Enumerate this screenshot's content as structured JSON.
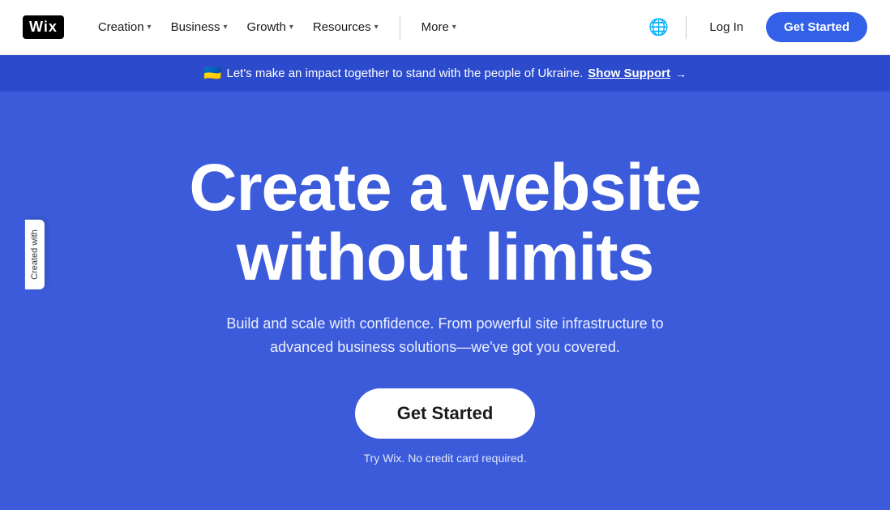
{
  "logo": {
    "text": "Wix"
  },
  "nav": {
    "items": [
      {
        "label": "Creation",
        "hasChevron": true
      },
      {
        "label": "Business",
        "hasChevron": true
      },
      {
        "label": "Growth",
        "hasChevron": true
      },
      {
        "label": "Resources",
        "hasChevron": true
      }
    ],
    "more": {
      "label": "More",
      "hasChevron": true
    },
    "login": "Log In",
    "get_started": "Get Started"
  },
  "banner": {
    "flag": "🇺🇦",
    "text": "Let's make an impact together to stand with the people of Ukraine.",
    "link_text": "Show Support",
    "arrow": "→"
  },
  "hero": {
    "title_line1": "Create a website",
    "title_line2": "without limits",
    "subtitle": "Build and scale with confidence. From powerful site infrastructure to advanced business solutions—we've got you covered.",
    "cta": "Get Started",
    "note": "Try Wix. No credit card required."
  },
  "side_tab": {
    "text": "Created with"
  }
}
